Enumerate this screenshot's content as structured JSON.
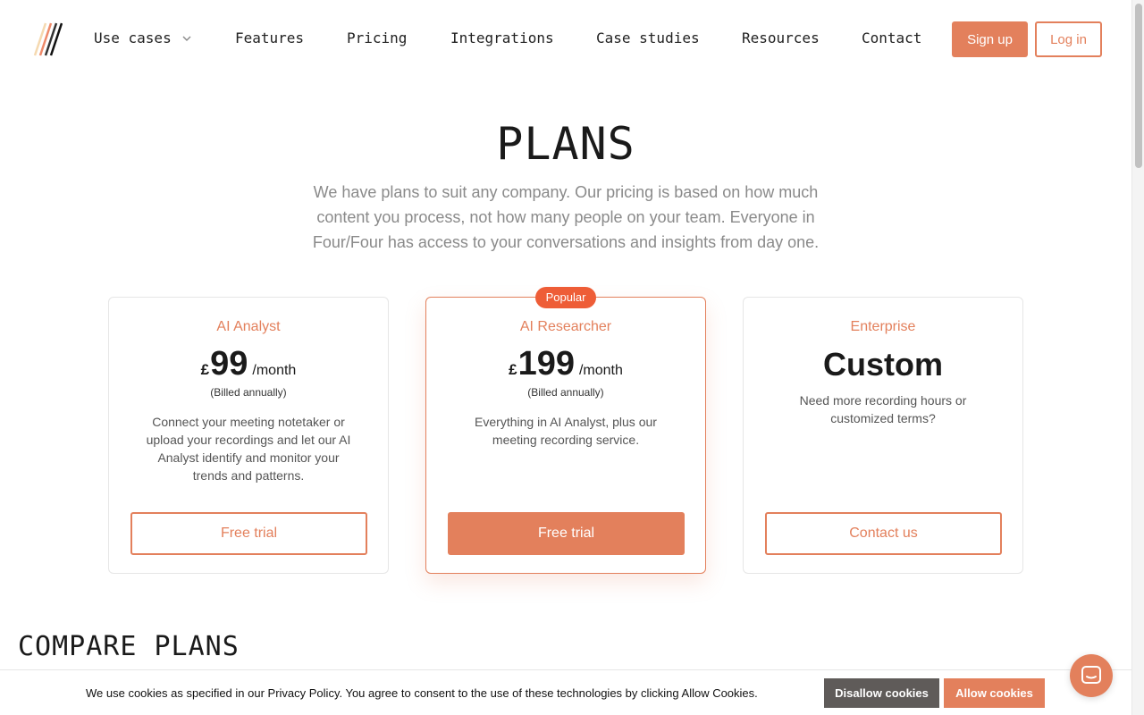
{
  "nav": {
    "items": [
      {
        "label": "Use cases",
        "has_dropdown": true
      },
      {
        "label": "Features"
      },
      {
        "label": "Pricing"
      },
      {
        "label": "Integrations"
      },
      {
        "label": "Case studies"
      },
      {
        "label": "Resources"
      },
      {
        "label": "Contact"
      }
    ],
    "signup_label": "Sign up",
    "login_label": "Log in"
  },
  "hero": {
    "title": "PLANS",
    "subtitle": "We have plans to suit any company. Our pricing is based on how much content you process, not how many people on your team. Everyone in Four/Four has access to your conversations and insights from day one."
  },
  "plans": [
    {
      "name": "AI Analyst",
      "currency": "£",
      "amount": "99",
      "period": "/month",
      "billed": "(Billed annually)",
      "description": "Connect your meeting notetaker or upload your recordings and let our AI Analyst identify and monitor your trends and patterns.",
      "button": "Free trial"
    },
    {
      "name": "AI Researcher",
      "badge": "Popular",
      "currency": "£",
      "amount": "199",
      "period": "/month",
      "billed": "(Billed annually)",
      "description": "Everything in AI Analyst, plus our meeting recording service.",
      "button": "Free trial"
    },
    {
      "name": "Enterprise",
      "price_text": "Custom",
      "description": "Need more recording hours or customized terms?",
      "button": "Contact us"
    }
  ],
  "compare": {
    "title": "COMPARE PLANS"
  },
  "cookie": {
    "text": "We use cookies as specified in our Privacy Policy. You agree to consent to the use of these technologies by clicking Allow Cookies.",
    "disallow_label": "Disallow cookies",
    "allow_label": "Allow cookies"
  },
  "colors": {
    "accent": "#e3805c",
    "badge": "#ee5d37",
    "disallow": "#5f5b59"
  },
  "icons": {
    "logo": "four-four-logo",
    "dropdown": "chevron-down-icon",
    "chat": "chat-bubble-icon"
  }
}
